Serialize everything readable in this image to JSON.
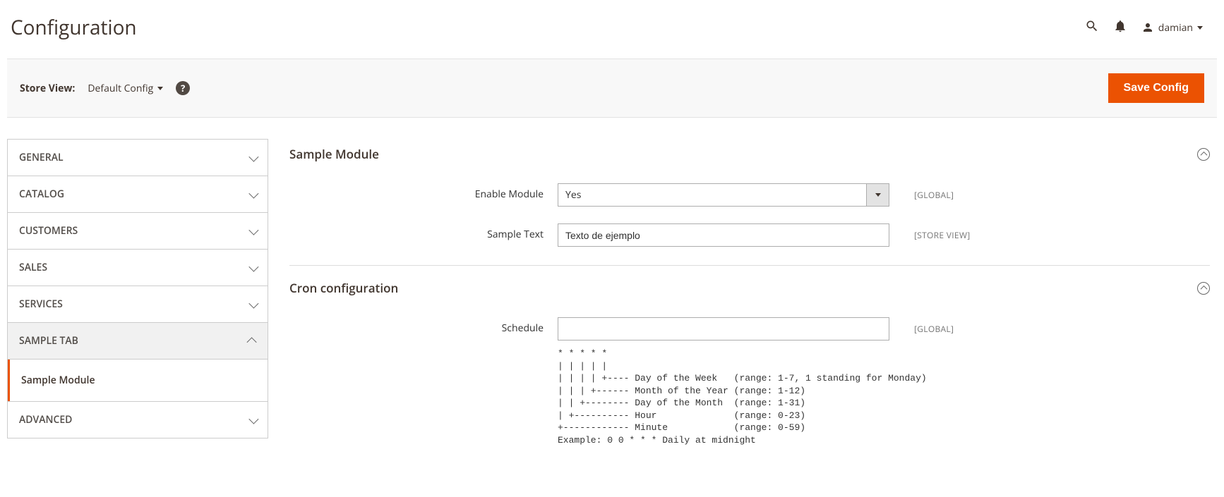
{
  "page": {
    "title": "Configuration"
  },
  "header": {
    "user": "damian"
  },
  "toolbar": {
    "store_view_label": "Store View:",
    "store_view_value": "Default Config",
    "save_label": "Save Config"
  },
  "sidebar": {
    "items": [
      {
        "label": "GENERAL",
        "expanded": false
      },
      {
        "label": "CATALOG",
        "expanded": false
      },
      {
        "label": "CUSTOMERS",
        "expanded": false
      },
      {
        "label": "SALES",
        "expanded": false
      },
      {
        "label": "SERVICES",
        "expanded": false
      },
      {
        "label": "SAMPLE TAB",
        "expanded": true,
        "sub": [
          {
            "label": "Sample Module",
            "active": true
          }
        ]
      },
      {
        "label": "ADVANCED",
        "expanded": false
      }
    ]
  },
  "sections": {
    "sample_module": {
      "title": "Sample Module",
      "fields": {
        "enable": {
          "label": "Enable Module",
          "value": "Yes",
          "scope": "[GLOBAL]"
        },
        "sample_text": {
          "label": "Sample Text",
          "value": "Texto de ejemplo",
          "scope": "[STORE VIEW]"
        }
      }
    },
    "cron": {
      "title": "Cron configuration",
      "fields": {
        "schedule": {
          "label": "Schedule",
          "value": "",
          "scope": "[GLOBAL]"
        }
      },
      "help_text": "* * * * *\n| | | | |\n| | | | +---- Day of the Week   (range: 1-7, 1 standing for Monday)\n| | | +------ Month of the Year (range: 1-12)\n| | +-------- Day of the Month  (range: 1-31)\n| +---------- Hour              (range: 0-23)\n+------------ Minute            (range: 0-59)\nExample: 0 0 * * * Daily at midnight"
    }
  }
}
